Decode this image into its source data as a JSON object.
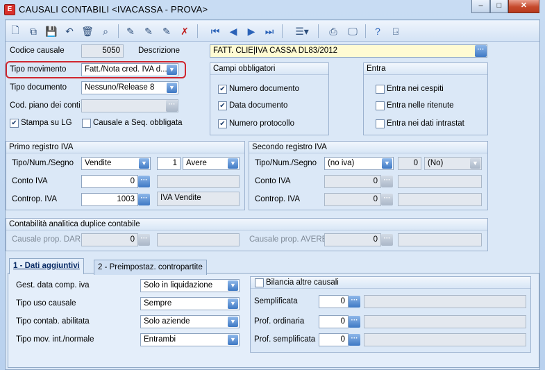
{
  "window": {
    "title": "CAUSALI CONTABILI <IVACASSA - PROVA>",
    "app_icon": "E",
    "minimize": "–",
    "maximize": "□",
    "close": "✕"
  },
  "toolbar": {
    "buttons": [
      "new",
      "copy",
      "save",
      "undo",
      "delete",
      "find",
      "edit1",
      "edit2",
      "edit3",
      "cancel",
      "first",
      "prev",
      "next",
      "last",
      "filter",
      "print",
      "preview",
      "help",
      "exit"
    ]
  },
  "header": {
    "codice_label": "Codice causale",
    "codice_value": "5050",
    "descrizione_label": "Descrizione",
    "descrizione_value": "FATT. CLIE|IVA CASSA DL83/2012",
    "tipo_mov_label": "Tipo movimento",
    "tipo_mov_value": "Fatt./Nota cred. IVA d...",
    "tipo_doc_label": "Tipo documento",
    "tipo_doc_value": "Nessuno/Release 8",
    "piano_label": "Cod. piano dei conti",
    "piano_value": "",
    "stampa_label": "Stampa  su LG",
    "stampa_checked": true,
    "seq_label": "Causale a Seq. obbligata",
    "seq_checked": false
  },
  "campi": {
    "title": "Campi obbligatori",
    "items": [
      {
        "label": "Numero documento",
        "checked": true
      },
      {
        "label": "Data documento",
        "checked": true
      },
      {
        "label": "Numero protocollo",
        "checked": true
      }
    ]
  },
  "entra": {
    "title": "Entra",
    "items": [
      {
        "label": "Entra nei cespiti",
        "checked": false
      },
      {
        "label": "Entra nelle ritenute",
        "checked": false
      },
      {
        "label": "Entra nei dati intrastat",
        "checked": false
      }
    ]
  },
  "primo": {
    "title": "Primo registro IVA",
    "tipo_label": "Tipo/Num./Segno",
    "tipo_value": "Vendite",
    "num_value": "1",
    "segno_value": "Avere",
    "conto_label": "Conto IVA",
    "conto_value": "0",
    "conto_desc": "",
    "controp_label": "Controp. IVA",
    "controp_value": "1003",
    "controp_desc": "IVA Vendite"
  },
  "secondo": {
    "title": "Secondo registro IVA",
    "tipo_label": "Tipo/Num./Segno",
    "tipo_value": "(no iva)",
    "num_value": "0",
    "segno_value": "(No)",
    "conto_label": "Conto IVA",
    "conto_value": "0",
    "controp_label": "Controp. IVA",
    "controp_value": "0"
  },
  "analitica": {
    "title": "Contabilità analitica duplice contabile",
    "dare_label": "Causale prop. DARE",
    "dare_value": "0",
    "avere_label": "Causale prop. AVERE",
    "avere_value": "0"
  },
  "tabs": [
    {
      "label": "1 - Dati aggiuntivi"
    },
    {
      "label": "2 - Preimpostaz. contropartite"
    }
  ],
  "dati": {
    "gest_label": "Gest. data comp. iva",
    "gest_value": "Solo in liquidazione",
    "uso_label": "Tipo uso causale",
    "uso_value": "Sempre",
    "contab_label": "Tipo contab. abilitata",
    "contab_value": "Solo aziende",
    "mov_label": "Tipo mov. int./normale",
    "mov_value": "Entrambi"
  },
  "bilancia": {
    "label": "Bilancia altre causali",
    "checked": false,
    "semplificata_label": "Semplificata",
    "semplificata_value": "0",
    "ordinaria_label": "Prof. ordinaria",
    "ordinaria_value": "0",
    "profsempl_label": "Prof. semplificata",
    "profsempl_value": "0"
  }
}
